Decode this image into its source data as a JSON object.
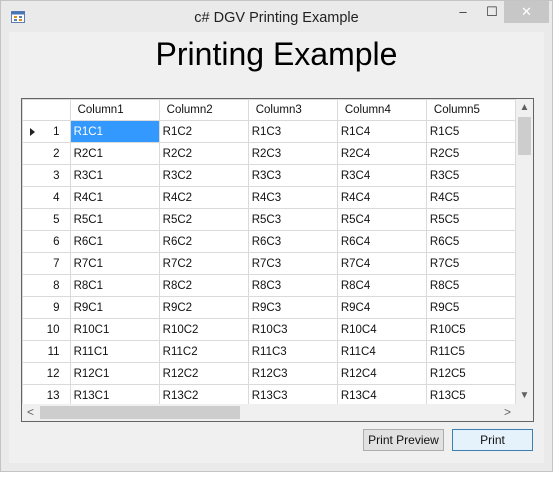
{
  "window": {
    "title": "c# DGV Printing Example",
    "controls": {
      "minimize": "–",
      "maximize": "☐",
      "close": "✕"
    }
  },
  "heading": "Printing Example",
  "grid": {
    "columns": [
      "Column1",
      "Column2",
      "Column3",
      "Column4",
      "Column5"
    ],
    "rows": [
      {
        "num": "1",
        "cells": [
          "R1C1",
          "R1C2",
          "R1C3",
          "R1C4",
          "R1C5"
        ]
      },
      {
        "num": "2",
        "cells": [
          "R2C1",
          "R2C2",
          "R2C3",
          "R2C4",
          "R2C5"
        ]
      },
      {
        "num": "3",
        "cells": [
          "R3C1",
          "R3C2",
          "R3C3",
          "R3C4",
          "R3C5"
        ]
      },
      {
        "num": "4",
        "cells": [
          "R4C1",
          "R4C2",
          "R4C3",
          "R4C4",
          "R4C5"
        ]
      },
      {
        "num": "5",
        "cells": [
          "R5C1",
          "R5C2",
          "R5C3",
          "R5C4",
          "R5C5"
        ]
      },
      {
        "num": "6",
        "cells": [
          "R6C1",
          "R6C2",
          "R6C3",
          "R6C4",
          "R6C5"
        ]
      },
      {
        "num": "7",
        "cells": [
          "R7C1",
          "R7C2",
          "R7C3",
          "R7C4",
          "R7C5"
        ]
      },
      {
        "num": "8",
        "cells": [
          "R8C1",
          "R8C2",
          "R8C3",
          "R8C4",
          "R8C5"
        ]
      },
      {
        "num": "9",
        "cells": [
          "R9C1",
          "R9C2",
          "R9C3",
          "R9C4",
          "R9C5"
        ]
      },
      {
        "num": "10",
        "cells": [
          "R10C1",
          "R10C2",
          "R10C3",
          "R10C4",
          "R10C5"
        ]
      },
      {
        "num": "11",
        "cells": [
          "R11C1",
          "R11C2",
          "R11C3",
          "R11C4",
          "R11C5"
        ]
      },
      {
        "num": "12",
        "cells": [
          "R12C1",
          "R12C2",
          "R12C3",
          "R12C4",
          "R12C5"
        ]
      },
      {
        "num": "13",
        "cells": [
          "R13C1",
          "R13C2",
          "R13C3",
          "R13C4",
          "R13C5"
        ]
      }
    ],
    "selected_cell": "R1C1",
    "selection_color": "#3399ff"
  },
  "scrollbars": {
    "up": "▲",
    "down": "▼",
    "left": "<",
    "right": ">"
  },
  "buttons": {
    "print_preview": "Print Preview",
    "print": "Print"
  }
}
